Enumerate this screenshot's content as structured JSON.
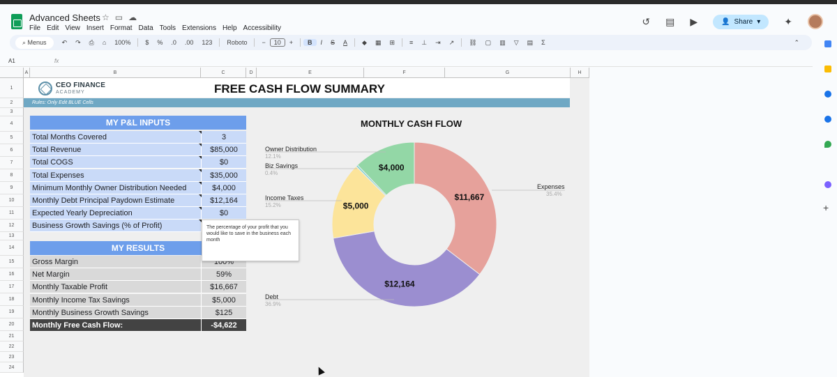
{
  "app": {
    "doc_title": "Advanced Sheets",
    "menu": [
      "File",
      "Edit",
      "View",
      "Insert",
      "Format",
      "Data",
      "Tools",
      "Extensions",
      "Help",
      "Accessibility"
    ],
    "share_label": "Share"
  },
  "toolbar": {
    "menus_label": "Menus",
    "zoom": "100%",
    "currency": "$",
    "percent": "%",
    "dec_less": ".0",
    "dec_more": ".00",
    "number_format": "123",
    "font": "Roboto",
    "font_size": "10",
    "minus": "−",
    "plus": "+",
    "bold": "B",
    "italic": "I",
    "strike": "S",
    "text_color": "A"
  },
  "formula_bar": {
    "name_box": "A1",
    "fx": "fx"
  },
  "columns": [
    "A",
    "B",
    "C",
    "D",
    "E",
    "F",
    "G",
    "H"
  ],
  "rows": [
    "1",
    "2",
    "3",
    "4",
    "5",
    "6",
    "7",
    "8",
    "9",
    "10",
    "11",
    "12",
    "13",
    "14",
    "15",
    "16",
    "17",
    "18",
    "19",
    "20",
    "21",
    "22",
    "23",
    "24"
  ],
  "sheet": {
    "brand_name": "CEO FINANCE",
    "brand_sub": "ACADEMY",
    "title": "FREE CASH FLOW SUMMARY",
    "rules": "Rules: Only Edit BLUE Cells",
    "inputs_header": "MY P&L INPUTS",
    "inputs": [
      {
        "label": "Total Months Covered",
        "value": "3"
      },
      {
        "label": "Total Revenue",
        "value": "$85,000"
      },
      {
        "label": "Total COGS",
        "value": "$0"
      },
      {
        "label": "Total Expenses",
        "value": "$35,000"
      },
      {
        "label": "Minimum Monthly Owner Distribution Needed",
        "value": "$4,000"
      },
      {
        "label": "Monthly Debt Principal Paydown Estimate",
        "value": "$12,164"
      },
      {
        "label": "Expected Yearly Depreciation",
        "value": "$0"
      },
      {
        "label": "Business Growth Savings (% of Profit)",
        "value": ""
      }
    ],
    "results_header": "MY RESULTS",
    "results": [
      {
        "label": "Gross Margin",
        "value": "100%"
      },
      {
        "label": "Net Margin",
        "value": "59%"
      },
      {
        "label": "Monthly Taxable Profit",
        "value": "$16,667"
      },
      {
        "label": "Monthly Income Tax Savings",
        "value": "$5,000"
      },
      {
        "label": "Monthly Business Growth Savings",
        "value": "$125"
      }
    ],
    "total": {
      "label": "Monthly Free Cash Flow:",
      "value": "-$4,622"
    },
    "tooltip": "The percentage of your profit that you would like to save in the business each month"
  },
  "chart_data": {
    "type": "pie",
    "title": "MONTHLY CASH FLOW",
    "donut": true,
    "slices": [
      {
        "name": "Expenses",
        "value": 11667,
        "label": "$11,667",
        "pct": "35.4%",
        "color": "#e6a19b"
      },
      {
        "name": "Debt",
        "value": 12164,
        "label": "$12,164",
        "pct": "36.9%",
        "color": "#9b8ed0"
      },
      {
        "name": "Income Taxes",
        "value": 5000,
        "label": "$5,000",
        "pct": "15.2%",
        "color": "#fce49a"
      },
      {
        "name": "Biz Savings",
        "value": 125,
        "label": "",
        "pct": "0.4%",
        "color": "#7fd3d0"
      },
      {
        "name": "Owner Distribution",
        "value": 4000,
        "label": "$4,000",
        "pct": "12.1%",
        "color": "#93d7a6"
      }
    ]
  },
  "colors": {
    "header_blue": "#6d9eeb",
    "input_blue": "#c9daf8",
    "rules_bar": "#6fa8c4",
    "total_row": "#434343"
  }
}
